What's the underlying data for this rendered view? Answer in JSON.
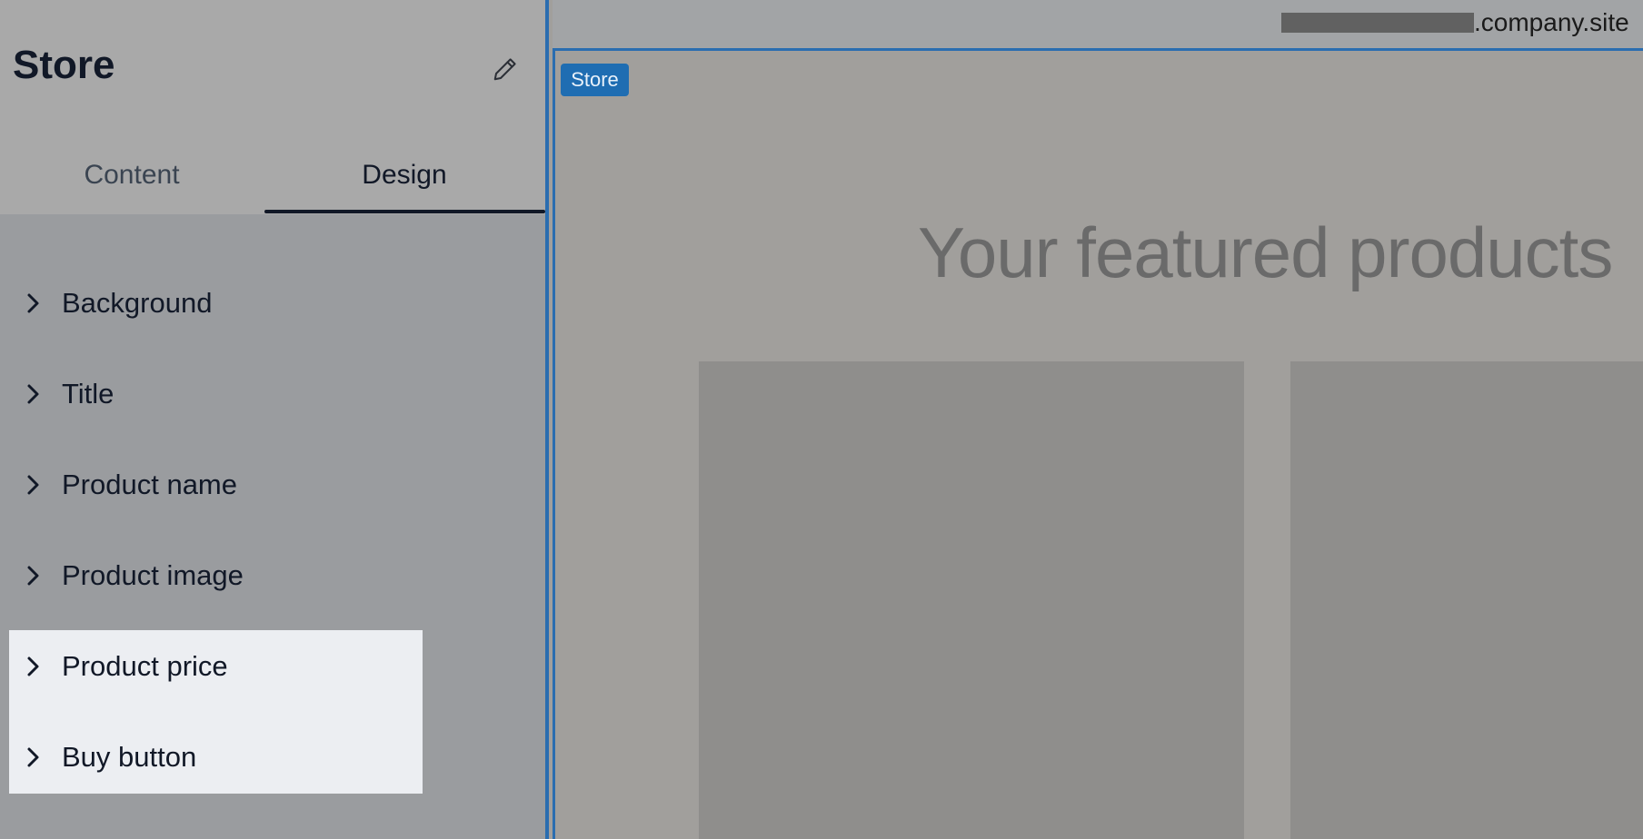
{
  "sidebar": {
    "title": "Store",
    "edit_icon": "pencil-icon",
    "tabs": [
      {
        "label": "Content",
        "active": false
      },
      {
        "label": "Design",
        "active": true
      }
    ],
    "items": [
      {
        "label": "Background",
        "icon": "chevron-right-icon"
      },
      {
        "label": "Title",
        "icon": "chevron-right-icon"
      },
      {
        "label": "Product name",
        "icon": "chevron-right-icon"
      },
      {
        "label": "Product image",
        "icon": "chevron-right-icon"
      },
      {
        "label": "Product price",
        "icon": "chevron-right-icon"
      },
      {
        "label": "Buy button",
        "icon": "chevron-right-icon"
      }
    ]
  },
  "preview": {
    "url_suffix": ".company.site",
    "section_badge": "Store",
    "featured_title": "Your featured products"
  },
  "colors": {
    "accent": "#2a6db0",
    "badge": "#1f6db2",
    "highlight": "#eceef2",
    "text_primary": "#111827"
  }
}
